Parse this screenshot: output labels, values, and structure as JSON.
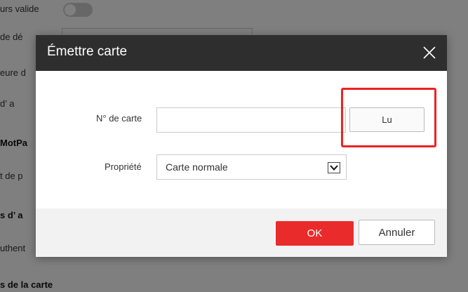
{
  "background": {
    "toggle_label": "urs valide",
    "row2": "de dé",
    "row3": "eure d",
    "row4": "d’ a",
    "section_motpasse": "MotPa",
    "row6": "t de p",
    "section_droits": "s d’ a",
    "row8": "uthent",
    "section_carte": "s de la carte"
  },
  "dialog": {
    "title": "Émettre carte",
    "close_icon": "close-icon",
    "card_number_label": "N° de carte",
    "card_number_value": "",
    "read_button_label": "Lu",
    "property_label": "Propriété",
    "property_selected": "Carte normale",
    "ok_label": "OK",
    "cancel_label": "Annuler"
  },
  "colors": {
    "header_bg": "#2e2e2e",
    "ok_button": "#ea2b2b",
    "highlight": "#ee2222",
    "footer_bg": "#f2f2f2"
  }
}
